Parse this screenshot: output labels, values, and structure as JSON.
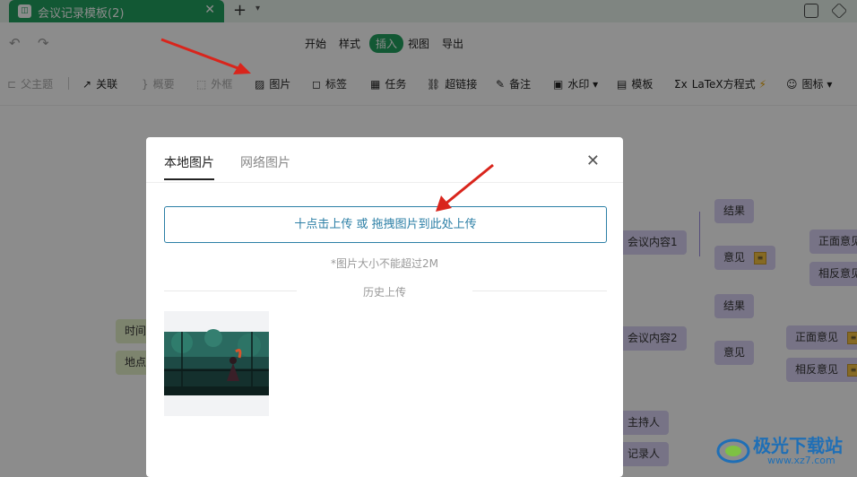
{
  "titlebar": {
    "tab_title": "会议记录模板(2)",
    "app_icon": "doc-icon",
    "new_tab": "+",
    "new_tab_menu": "▾"
  },
  "menubar": {
    "items": [
      "开始",
      "样式",
      "插入",
      "视图",
      "导出"
    ],
    "active": "插入"
  },
  "toolbar": {
    "items": [
      {
        "label": "父主题",
        "icon": "parent-topic-icon",
        "disabled": true
      },
      {
        "label": "关联",
        "icon": "relation-icon",
        "disabled": false
      },
      {
        "label": "概要",
        "icon": "summary-icon",
        "disabled": true
      },
      {
        "label": "外框",
        "icon": "boundary-icon",
        "disabled": true
      },
      {
        "label": "图片",
        "icon": "image-icon",
        "disabled": false
      },
      {
        "label": "标签",
        "icon": "label-icon",
        "disabled": false
      },
      {
        "label": "任务",
        "icon": "task-icon",
        "disabled": false
      },
      {
        "label": "超链接",
        "icon": "link-icon",
        "disabled": false
      },
      {
        "label": "备注",
        "icon": "note-icon",
        "disabled": false
      },
      {
        "label": "水印",
        "icon": "watermark-icon",
        "disabled": false
      },
      {
        "label": "模板",
        "icon": "template-icon",
        "disabled": false
      },
      {
        "label": "LaTeX方程式",
        "icon": "latex-icon",
        "disabled": false
      },
      {
        "label": "图标",
        "icon": "emoji-icon",
        "disabled": false
      }
    ]
  },
  "canvas": {
    "nodes_left": [
      "时间",
      "地点"
    ],
    "meeting1": {
      "title": "会议内容1",
      "result": "结果",
      "opinion": "意见",
      "positive": "正面意见",
      "negative": "相反意见"
    },
    "meeting2": {
      "title": "会议内容2",
      "result": "结果",
      "opinion": "意见",
      "positive": "正面意见",
      "negative": "相反意见"
    },
    "bottom_nodes": [
      "主持人",
      "记录人"
    ]
  },
  "dialog": {
    "tabs": [
      "本地图片",
      "网络图片"
    ],
    "active_tab": "本地图片",
    "upload_button": "十点击上传 或 拖拽图片到此处上传",
    "size_hint": "*图片大小不能超过2M",
    "history_label": "历史上传"
  },
  "watermark": {
    "brand": "极光下载站",
    "url": "www.xz7.com"
  },
  "colors": {
    "accent": "#22a05f",
    "link": "#2c7fa6",
    "node_purple": "#d9d2f5",
    "node_green": "#e3f0c8",
    "arrow_red": "#d9251c"
  }
}
